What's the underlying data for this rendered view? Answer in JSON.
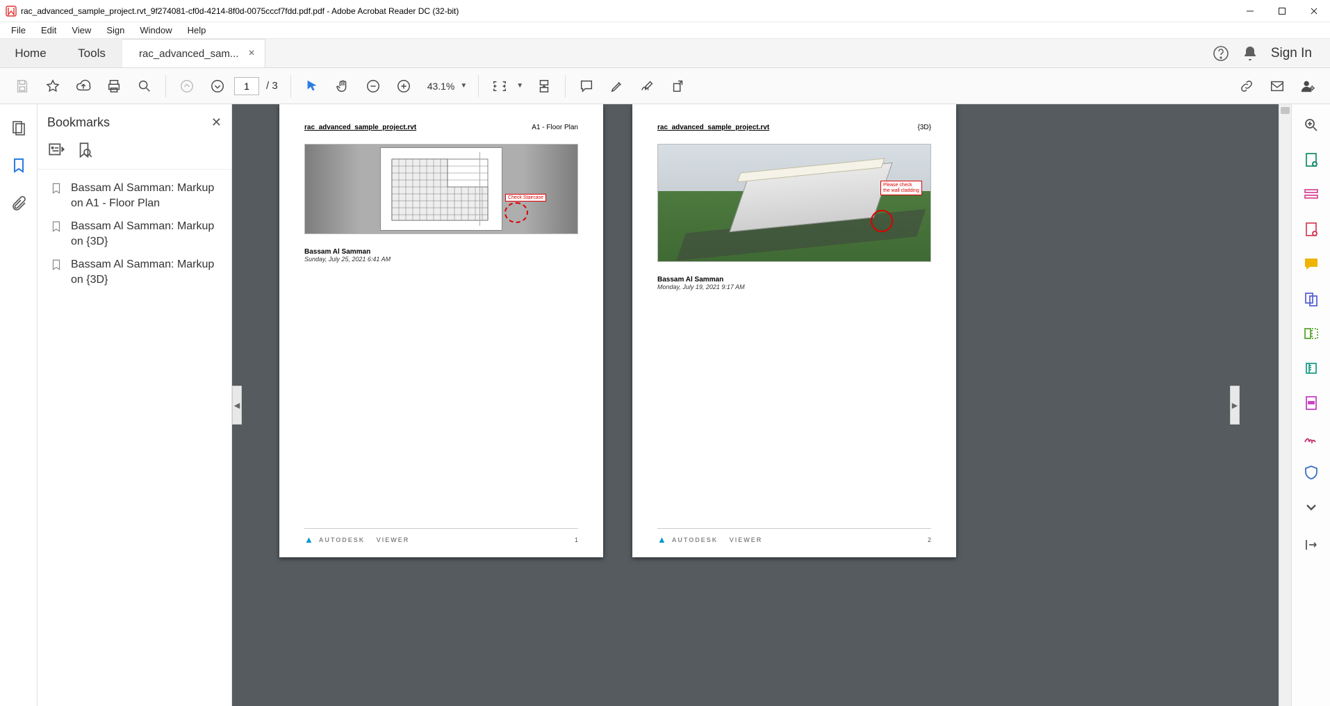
{
  "window": {
    "title": "rac_advanced_sample_project.rvt_9f274081-cf0d-4214-8f0d-0075cccf7fdd.pdf.pdf - Adobe Acrobat Reader DC (32-bit)"
  },
  "menu": {
    "items": [
      "File",
      "Edit",
      "View",
      "Sign",
      "Window",
      "Help"
    ]
  },
  "tabs": {
    "home": "Home",
    "tools": "Tools",
    "document": "rac_advanced_sam..."
  },
  "signin": "Sign In",
  "toolbar": {
    "page_current": "1",
    "page_total": "/ 3",
    "zoom_value": "43.1%"
  },
  "nav": {
    "title": "Bookmarks",
    "bookmarks": [
      "Bassam Al Samman: Markup on A1 - Floor Plan",
      "Bassam Al Samman: Markup on {3D}",
      "Bassam Al Samman: Markup on {3D}"
    ]
  },
  "pages": [
    {
      "filename": "rac_advanced_sample_project.rvt",
      "subtitle": "A1 - Floor Plan",
      "callout": "Check Staircase",
      "author": "Bassam Al Samman",
      "date": "Sunday, July 25, 2021 6:41 AM",
      "footer_brand": "AUTODESK",
      "footer_brand2": "VIEWER",
      "pageno": "1"
    },
    {
      "filename": "rac_advanced_sample_project.rvt",
      "subtitle": "{3D}",
      "callout": "Please check the wall cladding",
      "author": "Bassam Al Samman",
      "date": "Monday, July 19, 2021 9:17 AM",
      "footer_brand": "AUTODESK",
      "footer_brand2": "VIEWER",
      "pageno": "2"
    }
  ]
}
